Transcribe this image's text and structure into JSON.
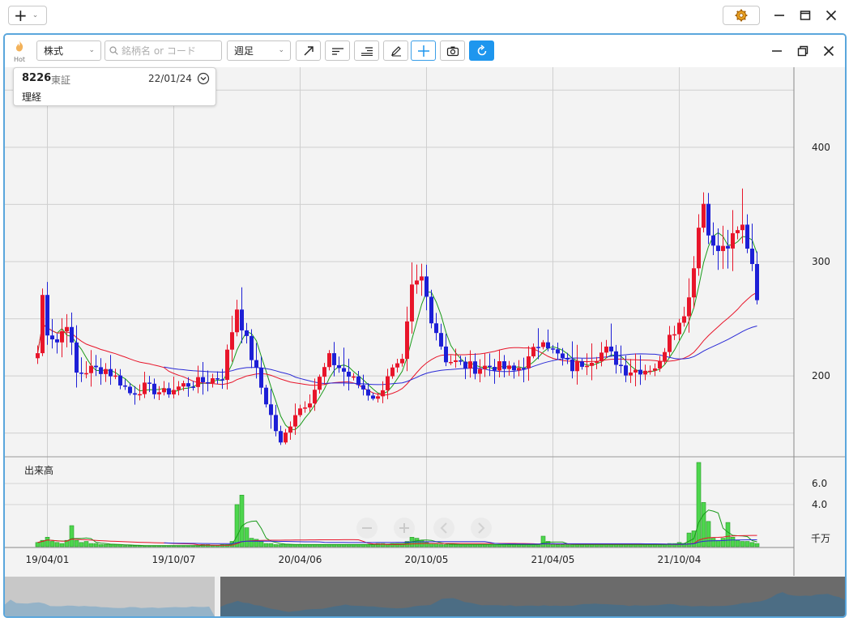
{
  "toolbar_top": {
    "add_menu_icon": "plus-icon",
    "settings_icon": "gear-icon",
    "window_controls": [
      "minimize-icon",
      "maximize-icon",
      "close-icon"
    ]
  },
  "chart_toolbar": {
    "hot_label": "Hot",
    "market_select": "株式",
    "search_placeholder": "銘柄名 or コード",
    "period_select": "週足",
    "tools": [
      "trendline-icon",
      "align-left-icon",
      "align-right-icon",
      "pencil-icon",
      "crosshair-icon",
      "camera-icon",
      "refresh-icon"
    ]
  },
  "info": {
    "code": "8226",
    "market": "東証",
    "date": "22/01/24",
    "name": "理経"
  },
  "volume_panel": {
    "title": "出来高",
    "unit": "千万"
  },
  "colors": {
    "up": "#e8152a",
    "down": "#1d1fd6",
    "ma_short": "#1a9a1a",
    "ma_mid": "#e8152a",
    "ma_long": "#2a2ad6",
    "volume": "#4dd64d",
    "accent": "#1e96ee"
  },
  "chart_data": [
    {
      "type": "candlestick",
      "interval": "weekly",
      "y_ticks": [
        200,
        300,
        400
      ],
      "ylim": [
        130,
        470
      ],
      "x_tick_labels": [
        "19/04/01",
        "19/10/07",
        "20/04/06",
        "20/10/05",
        "21/04/05",
        "21/10/04"
      ],
      "x_tick_index": [
        2,
        28,
        54,
        80,
        106,
        132
      ],
      "anchors": [
        [
          0,
          220
        ],
        [
          1,
          270
        ],
        [
          2,
          240
        ],
        [
          4,
          230
        ],
        [
          6,
          248
        ],
        [
          8,
          202
        ],
        [
          11,
          206
        ],
        [
          14,
          206
        ],
        [
          17,
          195
        ],
        [
          19,
          185
        ],
        [
          22,
          190
        ],
        [
          26,
          185
        ],
        [
          30,
          192
        ],
        [
          34,
          195
        ],
        [
          38,
          200
        ],
        [
          41,
          260
        ],
        [
          43,
          230
        ],
        [
          46,
          190
        ],
        [
          48,
          165
        ],
        [
          50,
          140
        ],
        [
          53,
          168
        ],
        [
          56,
          180
        ],
        [
          60,
          215
        ],
        [
          64,
          200
        ],
        [
          68,
          185
        ],
        [
          70,
          180
        ],
        [
          72,
          202
        ],
        [
          75,
          210
        ],
        [
          77,
          275
        ],
        [
          79,
          285
        ],
        [
          81,
          252
        ],
        [
          84,
          215
        ],
        [
          87,
          210
        ],
        [
          90,
          207
        ],
        [
          94,
          209
        ],
        [
          98,
          204
        ],
        [
          101,
          214
        ],
        [
          104,
          235
        ],
        [
          106,
          221
        ],
        [
          110,
          207
        ],
        [
          114,
          216
        ],
        [
          117,
          222
        ],
        [
          121,
          205
        ],
        [
          125,
          206
        ],
        [
          128,
          210
        ],
        [
          130,
          240
        ],
        [
          132,
          245
        ],
        [
          134,
          270
        ],
        [
          136,
          330
        ],
        [
          137,
          352
        ],
        [
          139,
          310
        ],
        [
          141,
          310
        ],
        [
          143,
          318
        ],
        [
          145,
          330
        ],
        [
          147,
          300
        ],
        [
          148,
          272
        ]
      ],
      "last_close": 272,
      "ma_lines": [
        {
          "name": "short",
          "period": 5
        },
        {
          "name": "mid",
          "period": 26
        },
        {
          "name": "long",
          "period": 52
        }
      ]
    },
    {
      "type": "bar",
      "y_ticks": [
        4.0,
        6.0
      ],
      "ylim": [
        0,
        8
      ],
      "values": [
        0.4,
        0.6,
        0.9,
        0.5,
        0.4,
        0.3,
        0.6,
        2.0,
        0.6,
        0.4,
        0.5,
        0.3,
        0.3,
        0.2,
        0.2,
        0.2,
        0.2,
        0.2,
        0.1,
        0.1,
        0.1,
        0.1,
        0.1,
        0.1,
        0.1,
        0.1,
        0.1,
        0.1,
        0.1,
        0.1,
        0.1,
        0.1,
        0.1,
        0.1,
        0.2,
        0.2,
        0.1,
        0.1,
        0.2,
        0.2,
        0.5,
        4.0,
        4.9,
        1.8,
        0.8,
        0.7,
        0.5,
        0.3,
        0.3,
        0.2,
        0.2,
        0.2,
        0.2,
        0.2,
        0.2,
        0.2,
        0.2,
        0.2,
        0.2,
        0.2,
        0.2,
        0.2,
        0.2,
        0.2,
        0.2,
        0.2,
        0.2,
        0.2,
        0.2,
        0.2,
        0.3,
        0.3,
        0.2,
        0.3,
        0.3,
        0.3,
        0.5,
        0.9,
        0.8,
        0.6,
        0.4,
        0.3,
        0.3,
        0.2,
        0.2,
        0.2,
        0.2,
        0.2,
        0.2,
        0.2,
        0.2,
        0.2,
        0.2,
        0.2,
        0.2,
        0.2,
        0.2,
        0.2,
        0.2,
        0.2,
        0.2,
        0.2,
        0.2,
        0.2,
        1.0,
        0.5,
        0.3,
        0.2,
        0.2,
        0.2,
        0.2,
        0.2,
        0.2,
        0.2,
        0.2,
        0.2,
        0.2,
        0.2,
        0.2,
        0.2,
        0.2,
        0.2,
        0.2,
        0.2,
        0.2,
        0.2,
        0.2,
        0.2,
        0.2,
        0.2,
        0.3,
        0.3,
        0.4,
        0.3,
        1.3,
        1.5,
        8.0,
        4.2,
        2.4,
        0.8,
        0.6,
        0.8,
        2.3,
        0.9,
        0.6,
        0.5,
        0.5,
        0.4,
        0.3
      ]
    }
  ]
}
